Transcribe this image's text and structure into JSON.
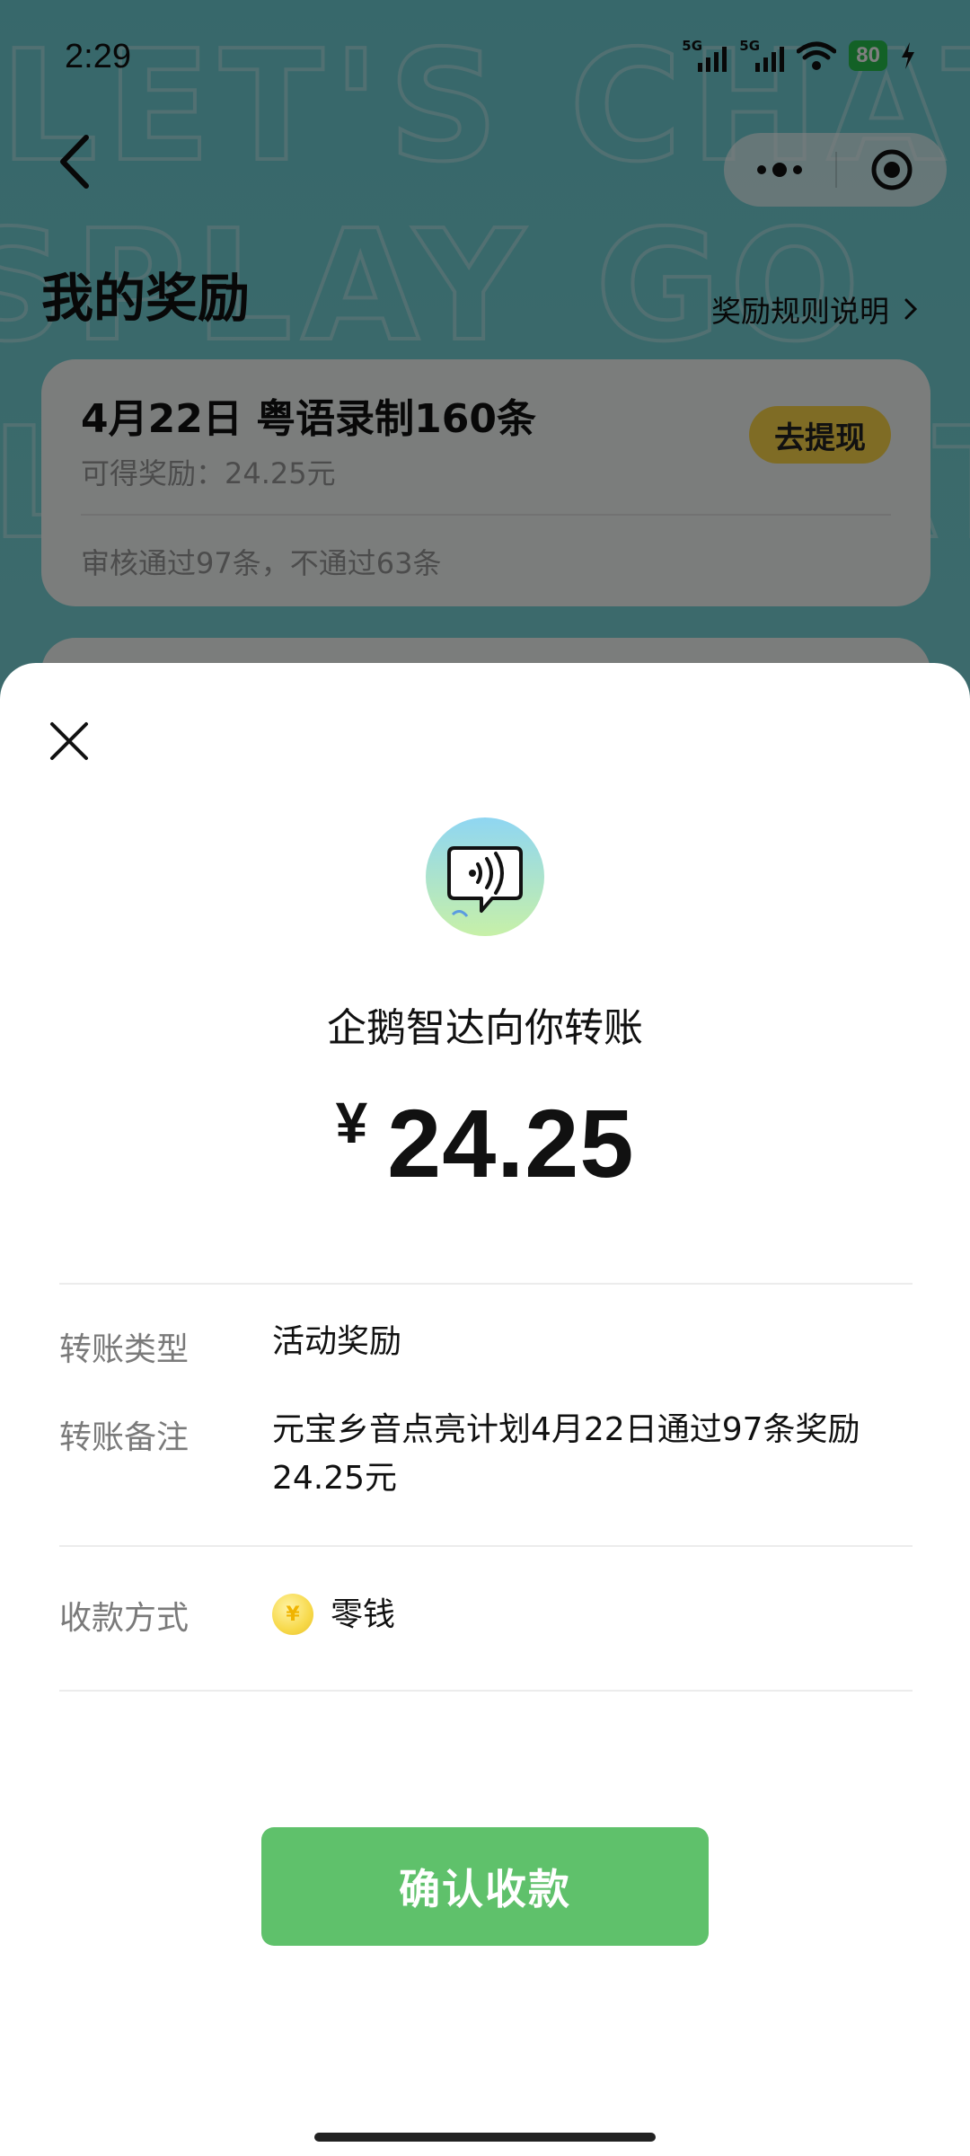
{
  "status_bar": {
    "time": "2:29",
    "signal1_label": "5G",
    "signal2_label": "5G",
    "battery": "80"
  },
  "background_page": {
    "title": "我的奖励",
    "rules_link": "奖励规则说明",
    "card": {
      "title": "4月22日 粤语录制160条",
      "reward": "可得奖励：24.25元",
      "review": "审核通过97条，不通过63条",
      "withdraw_label": "去提现"
    }
  },
  "sheet": {
    "payer_line": "企鹅智达向你转账",
    "currency": "¥",
    "amount": "24.25",
    "rows": {
      "type_label": "转账类型",
      "type_value": "活动奖励",
      "note_label": "转账备注",
      "note_value": "元宝乡音点亮计划4月22日通过97条奖励24.25元",
      "method_label": "收款方式",
      "method_value": "零钱"
    },
    "confirm_label": "确认收款"
  },
  "icons": {
    "back": "chevron-left-icon",
    "more": "more-dots-icon",
    "miniapp_close": "target-circle-icon",
    "sheet_close": "close-icon",
    "coin": "coin-icon",
    "payer_avatar": "speech-bubble-sound-icon"
  },
  "colors": {
    "confirm_green": "#5fc16b",
    "withdraw_yellow": "#ffd84a",
    "battery_green": "#27c24c"
  }
}
